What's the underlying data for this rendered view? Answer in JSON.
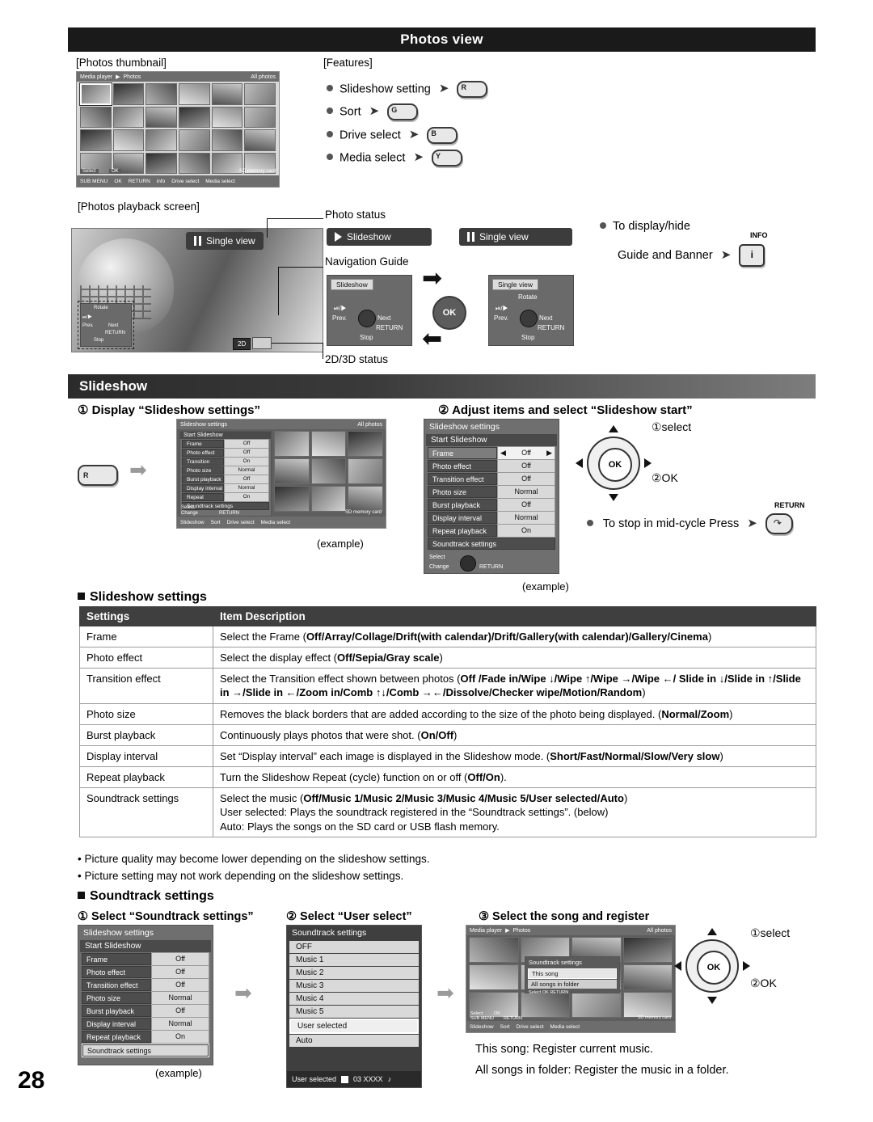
{
  "page_number": "28",
  "headers": {
    "photos_view": "Photos view",
    "slideshow": "Slideshow"
  },
  "labels": {
    "photos_thumbnail": "[Photos thumbnail]",
    "features": "[Features]",
    "photos_playback_screen": "[Photos playback screen]",
    "photo_status": "Photo status",
    "navigation_guide": "Navigation Guide",
    "status_2d3d": "2D/3D status",
    "example": "(example)"
  },
  "features": [
    {
      "label": "Slideshow setting",
      "button": "R"
    },
    {
      "label": "Sort",
      "button": "G"
    },
    {
      "label": "Drive select",
      "button": "B"
    },
    {
      "label": "Media select",
      "button": "Y"
    }
  ],
  "display_hide": {
    "line1": "To display/hide",
    "line2": "Guide and Banner",
    "button": "INFO",
    "icon": "info-icon"
  },
  "thumbnail_screen": {
    "top_left": "Media player",
    "top_mid": "Photos",
    "top_right": "All photos",
    "bottom": [
      "Select",
      "OK",
      "info",
      "SD memory card"
    ],
    "bottom_bar": [
      "SUB MENU",
      "OK",
      "RETURN",
      "info",
      "Drive select",
      "Media select"
    ]
  },
  "playback": {
    "single_view_chip": "Single view",
    "status_slideshow": "Slideshow",
    "status_single_view": "Single view",
    "badge_2d": "2D"
  },
  "guide_left": {
    "title": "Slideshow",
    "rows": [
      "Prev.",
      "Next",
      "Stop",
      "RETURN"
    ],
    "ok": "OK"
  },
  "guide_right": {
    "title": "Single view",
    "rotate": "Rotate",
    "rows": [
      "Prev.",
      "Next",
      "Stop",
      "RETURN"
    ]
  },
  "step1": {
    "circ": "①",
    "title": "Display “Slideshow settings”",
    "button": "R"
  },
  "step2": {
    "circ": "②",
    "title": "Adjust items and select “Slideshow start”",
    "select": "①select",
    "ok": "②OK",
    "stop_text": "To stop in mid-cycle Press",
    "return_button": "RETURN"
  },
  "settings_menu": {
    "title": "Slideshow settings",
    "start": "Start Slideshow",
    "rows": [
      {
        "label": "Frame",
        "value": "Off"
      },
      {
        "label": "Photo effect",
        "value": "Off"
      },
      {
        "label": "Transition effect",
        "value": "On"
      },
      {
        "label": "Photo size",
        "value": "Normal"
      },
      {
        "label": "Burst playback",
        "value": "Off"
      },
      {
        "label": "Display interval",
        "value": "Normal"
      },
      {
        "label": "Repeat playback",
        "value": "On"
      },
      {
        "label": "Soundtrack settings",
        "value": ""
      }
    ],
    "footer_select": "Select",
    "footer_change": "Change",
    "footer_return": "RETURN",
    "all_photos": "All photos"
  },
  "settings_menu_b": {
    "title": "Slideshow settings",
    "start": "Start Slideshow",
    "rows": [
      {
        "label": "Frame",
        "value": "Off"
      },
      {
        "label": "Photo effect",
        "value": "Off"
      },
      {
        "label": "Transition effect",
        "value": "Off"
      },
      {
        "label": "Photo size",
        "value": "Normal"
      },
      {
        "label": "Burst playback",
        "value": "Off"
      },
      {
        "label": "Display interval",
        "value": "Normal"
      },
      {
        "label": "Repeat playback",
        "value": "On"
      },
      {
        "label": "Soundtrack settings",
        "value": ""
      }
    ],
    "footer_select": "Select",
    "footer_change": "Change",
    "footer_return": "RETURN"
  },
  "slideshow_settings_heading": "Slideshow settings",
  "table": {
    "headers": [
      "Settings",
      "Item Description"
    ],
    "rows": [
      {
        "setting": "Frame",
        "desc_parts": [
          {
            "t": "Select the Frame (",
            "b": false
          },
          {
            "t": "Off/Array/Collage/Drift(with calendar)/Drift/Gallery(with calendar)/Gallery/Cinema",
            "b": true
          },
          {
            "t": ")",
            "b": false
          }
        ]
      },
      {
        "setting": "Photo effect",
        "desc_parts": [
          {
            "t": "Select the display effect (",
            "b": false
          },
          {
            "t": "Off/Sepia/Gray scale",
            "b": true
          },
          {
            "t": ")",
            "b": false
          }
        ]
      },
      {
        "setting": "Transition effect",
        "desc_parts": [
          {
            "t": "Select the Transition effect shown between photos (",
            "b": false
          },
          {
            "t": "Off /Fade in/Wipe ↓/Wipe ↑/Wipe →/Wipe ←/ Slide in ↓/Slide in ↑/Slide in →/Slide in ←/Zoom in/Comb ↑↓/Comb →←/Dissolve/Checker wipe/Motion/Random",
            "b": true
          },
          {
            "t": ")",
            "b": false
          }
        ]
      },
      {
        "setting": "Photo size",
        "desc_parts": [
          {
            "t": "Removes the black borders that are added according to the size of the photo being displayed. (",
            "b": false
          },
          {
            "t": "Normal/Zoom",
            "b": true
          },
          {
            "t": ")",
            "b": false
          }
        ]
      },
      {
        "setting": "Burst playback",
        "desc_parts": [
          {
            "t": "Continuously plays photos that were shot. (",
            "b": false
          },
          {
            "t": "On/Off",
            "b": true
          },
          {
            "t": ")",
            "b": false
          }
        ]
      },
      {
        "setting": "Display interval",
        "desc_parts": [
          {
            "t": "Set “Display interval” each image is displayed in the Slideshow mode. (",
            "b": false
          },
          {
            "t": "Short/Fast/Normal/Slow/Very slow",
            "b": true
          },
          {
            "t": ")",
            "b": false
          }
        ]
      },
      {
        "setting": "Repeat playback",
        "desc_parts": [
          {
            "t": "Turn the Slideshow Repeat (cycle) function on or off (",
            "b": false
          },
          {
            "t": "Off/On",
            "b": true
          },
          {
            "t": ").",
            "b": false
          }
        ]
      },
      {
        "setting": "Soundtrack settings",
        "desc_parts": [
          {
            "t": "Select the music (",
            "b": false
          },
          {
            "t": "Off/Music 1/Music 2/Music 3/Music 4/Music 5/User selected/Auto",
            "b": true
          },
          {
            "t": ")",
            "b": false
          },
          {
            "t": "\nUser selected: Plays the soundtrack registered in the “Soundtrack settings”. (below)\nAuto: Plays the songs on the SD card or USB flash memory.",
            "b": false
          }
        ]
      }
    ]
  },
  "notes": [
    "Picture quality may become lower depending on the slideshow settings.",
    "Picture setting may not work depending on the slideshow settings."
  ],
  "soundtrack": {
    "heading": "Soundtrack settings",
    "step1": "① Select “Soundtrack settings”",
    "step2": "② Select “User select”",
    "step3": "③ Select the song and register",
    "select": "①select",
    "ok": "②OK",
    "note1": "This song: Register current music.",
    "note2": "All songs in folder: Register the music in a folder.",
    "example": "(example)",
    "menu_title": "Soundtrack settings",
    "options": [
      "OFF",
      "Music 1",
      "Music 2",
      "Music 3",
      "Music 4",
      "Music 5",
      "User selected",
      "Auto"
    ],
    "selected_option": "User selected",
    "footer_selected": "User selected",
    "footer_track": "03 XXXX",
    "popup_title": "Soundtrack settings",
    "popup_items": [
      "This song",
      "All songs in folder"
    ],
    "popup_footer": [
      "Select",
      "OK",
      "RETURN"
    ],
    "screen_top": [
      "Media player",
      "Photos",
      "All photos"
    ],
    "screen_bottom": [
      "Slideshow",
      "Sort",
      "Drive select",
      "Media select"
    ],
    "screen_bottom_left": [
      "Select",
      "OK",
      "SUB MENU",
      "RETURN"
    ],
    "screen_bottom_right": "SD memory card"
  }
}
